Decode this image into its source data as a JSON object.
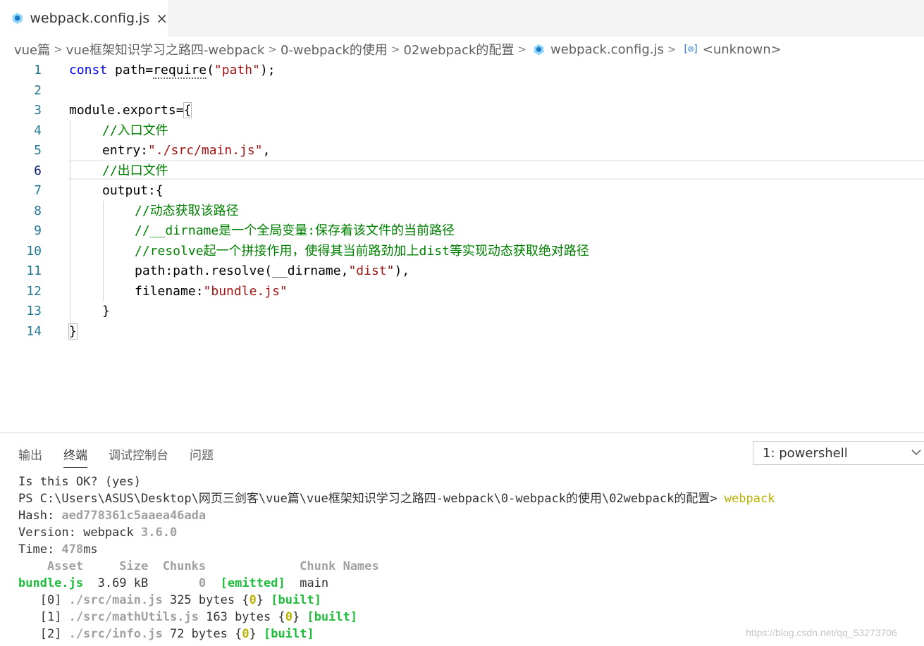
{
  "tab": {
    "label": "webpack.config.js",
    "close": "×"
  },
  "breadcrumb": {
    "items": [
      "vue篇",
      "vue框架知识学习之路四-webpack",
      "0-webpack的使用",
      "02webpack的配置",
      "webpack.config.js",
      "<unknown>"
    ],
    "separator": ">",
    "symbol_icon_text": "[⊘]"
  },
  "editor": {
    "line_numbers": [
      "1",
      "2",
      "3",
      "4",
      "5",
      "6",
      "7",
      "8",
      "9",
      "10",
      "11",
      "12",
      "13",
      "14"
    ],
    "lines": {
      "l1": {
        "kw": "const",
        "a": " path=",
        "b": "require",
        "c": "(",
        "str": "\"path\"",
        "d": ");"
      },
      "l3": {
        "a": "module.exports=",
        "brace": "{"
      },
      "l4": {
        "cmt": "//入口文件"
      },
      "l5": {
        "a": "entry:",
        "str": "\"./src/main.js\"",
        "b": ","
      },
      "l6": {
        "cmt": "//出口文件"
      },
      "l7": {
        "a": "output:{"
      },
      "l8": {
        "cmt": "//动态获取该路径"
      },
      "l9": {
        "cmt": "//__dirname是一个全局变量:保存着该文件的当前路径"
      },
      "l10": {
        "cmt": "//resolve起一个拼接作用，使得其当前路劲加上dist等实现动态获取绝对路径"
      },
      "l11": {
        "a": "path:path.resolve(__dirname,",
        "str": "\"dist\"",
        "b": "),"
      },
      "l12": {
        "a": "filename:",
        "str": "\"bundle.js\""
      },
      "l13": {
        "a": "}"
      },
      "l14": {
        "brace": "}"
      }
    }
  },
  "panel": {
    "tabs": [
      "输出",
      "终端",
      "调试控制台",
      "问题"
    ],
    "active_tab": "终端",
    "terminal_select": "1: powershell"
  },
  "terminal": {
    "l1": "Is this OK? (yes)",
    "l2_prompt": "PS C:\\Users\\ASUS\\Desktop\\网页三剑客\\vue篇\\vue框架知识学习之路四-webpack\\0-webpack的使用\\02webpack的配置> ",
    "l2_cmd": "webpack",
    "l3_label": "Hash: ",
    "l3_value": "aed778361c5aaea46ada",
    "l4_label": "Version: webpack ",
    "l4_value": "3.6.0",
    "l5_label": "Time: ",
    "l5_value": "478",
    "l5_unit": "ms",
    "header": "    Asset     Size  Chunks             Chunk Names",
    "asset_name": "bundle.js",
    "asset_size": "  3.69 kB",
    "asset_chunk": "       0",
    "asset_emitted": "  [emitted]",
    "asset_chunkname": "  main",
    "modules": [
      {
        "idx": "   [0] ",
        "path": "./src/main.js",
        "size": " 325 bytes {",
        "chunk": "0",
        "close": "} ",
        "built": "[built]"
      },
      {
        "idx": "   [1] ",
        "path": "./src/mathUtils.js",
        "size": " 163 bytes {",
        "chunk": "0",
        "close": "} ",
        "built": "[built]"
      },
      {
        "idx": "   [2] ",
        "path": "./src/info.js",
        "size": " 72 bytes {",
        "chunk": "0",
        "close": "} ",
        "built": "[built]"
      }
    ]
  },
  "watermark": "https://blog.csdn.net/qq_53273706"
}
